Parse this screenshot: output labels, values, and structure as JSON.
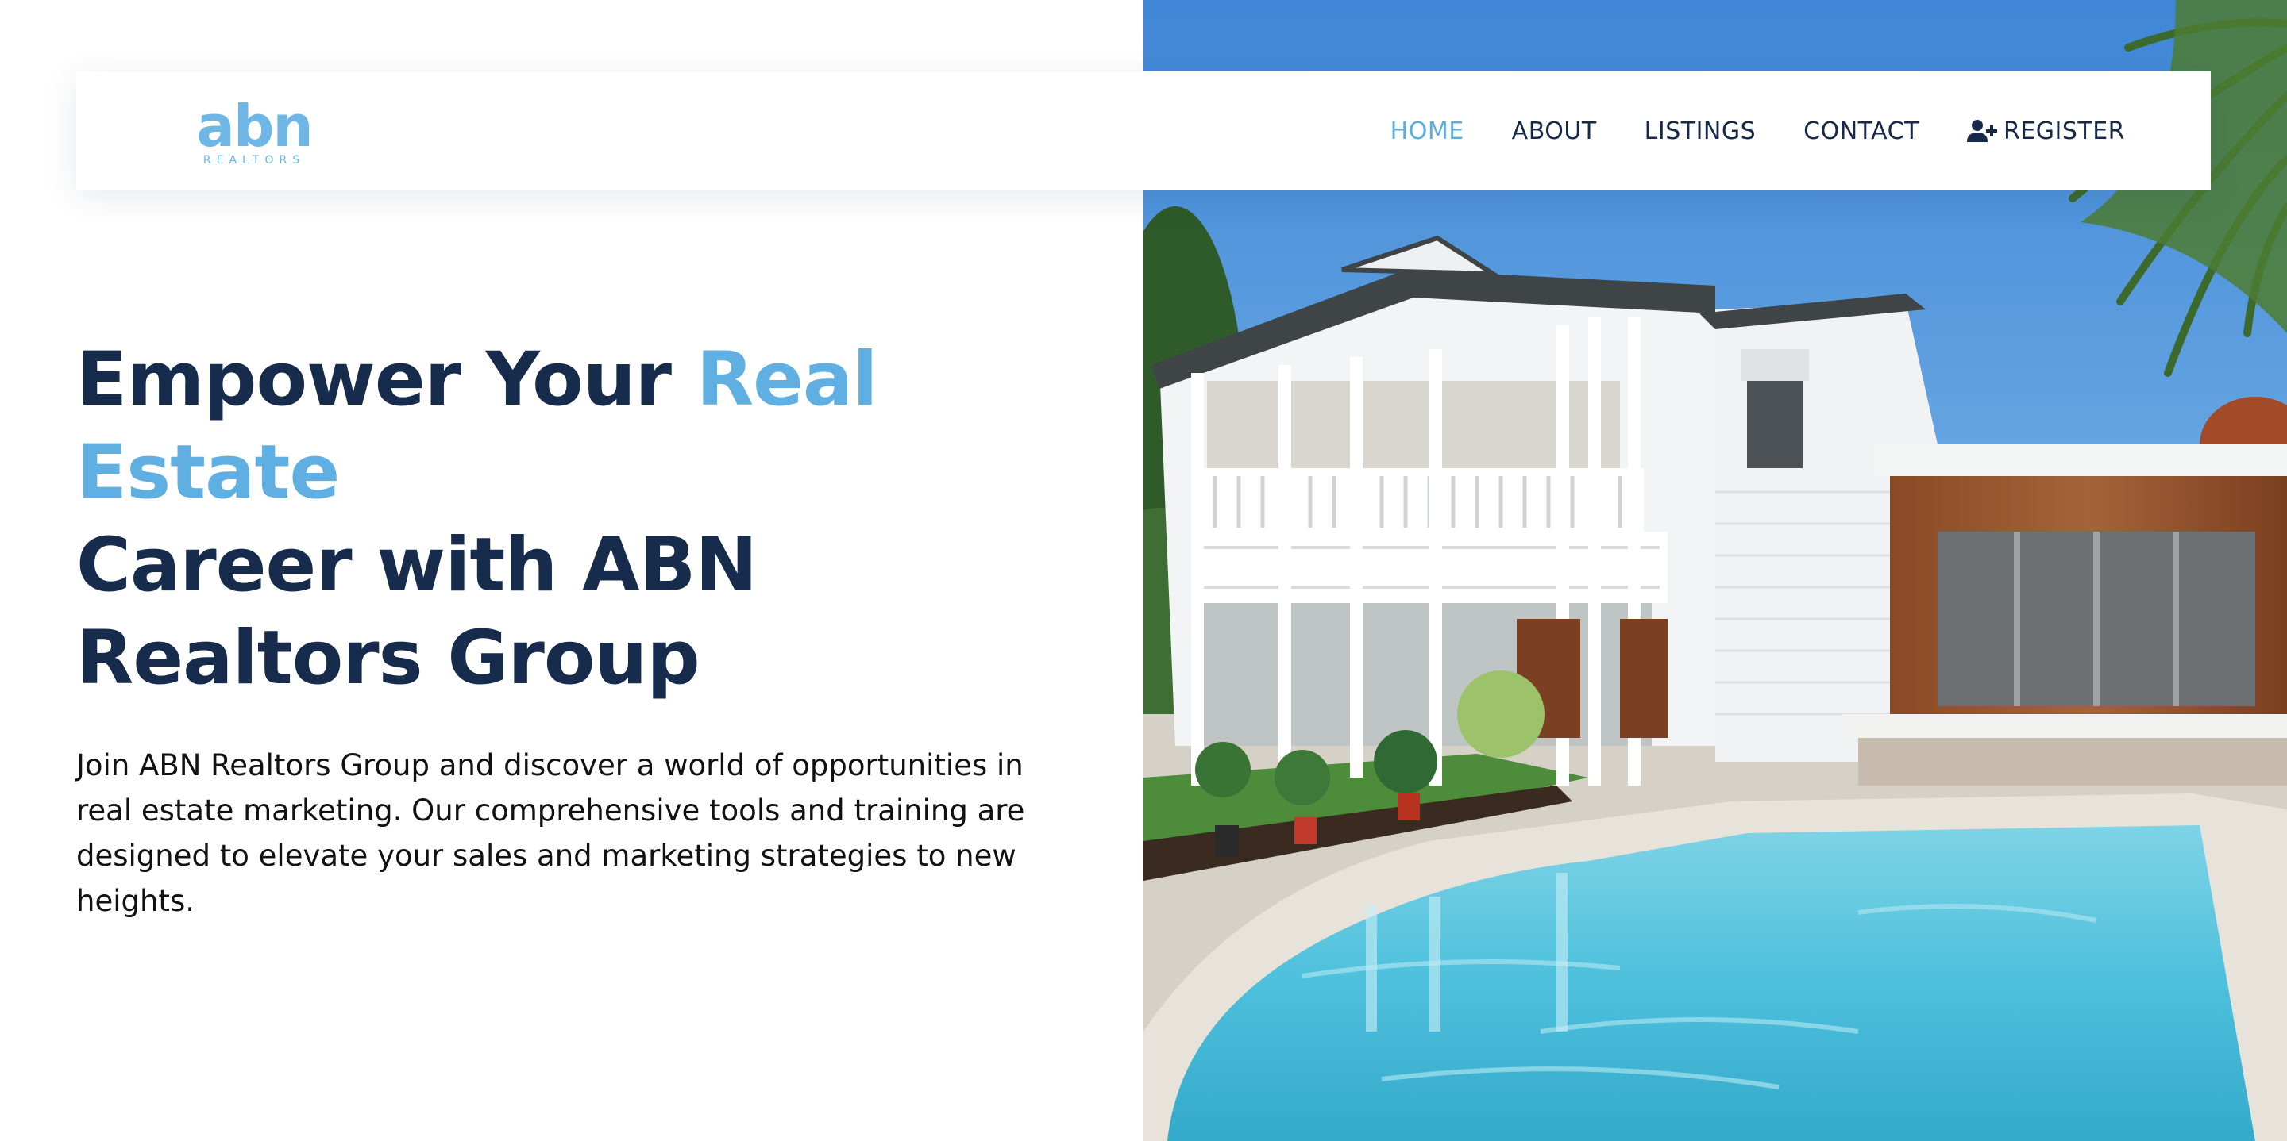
{
  "brand": {
    "logo_word": "abn",
    "logo_tagline": "REALTORS",
    "accent_color": "#5fafe2",
    "primary_color": "#172b4d"
  },
  "nav": {
    "items": [
      {
        "label": "HOME",
        "active": true
      },
      {
        "label": "ABOUT",
        "active": false
      },
      {
        "label": "LISTINGS",
        "active": false
      },
      {
        "label": "CONTACT",
        "active": false
      },
      {
        "label": "REGISTER",
        "active": false,
        "icon": "user-plus-icon"
      }
    ]
  },
  "hero": {
    "title_part1": "Empower Your ",
    "title_accent": "Real Estate",
    "title_part2": "Career with ABN Realtors Group",
    "description": "Join ABN Realtors Group and discover a world of opportunities in real estate marketing. Our comprehensive tools and training are designed to elevate your sales and marketing strategies to new heights.",
    "image": "house-with-pool-photo"
  }
}
